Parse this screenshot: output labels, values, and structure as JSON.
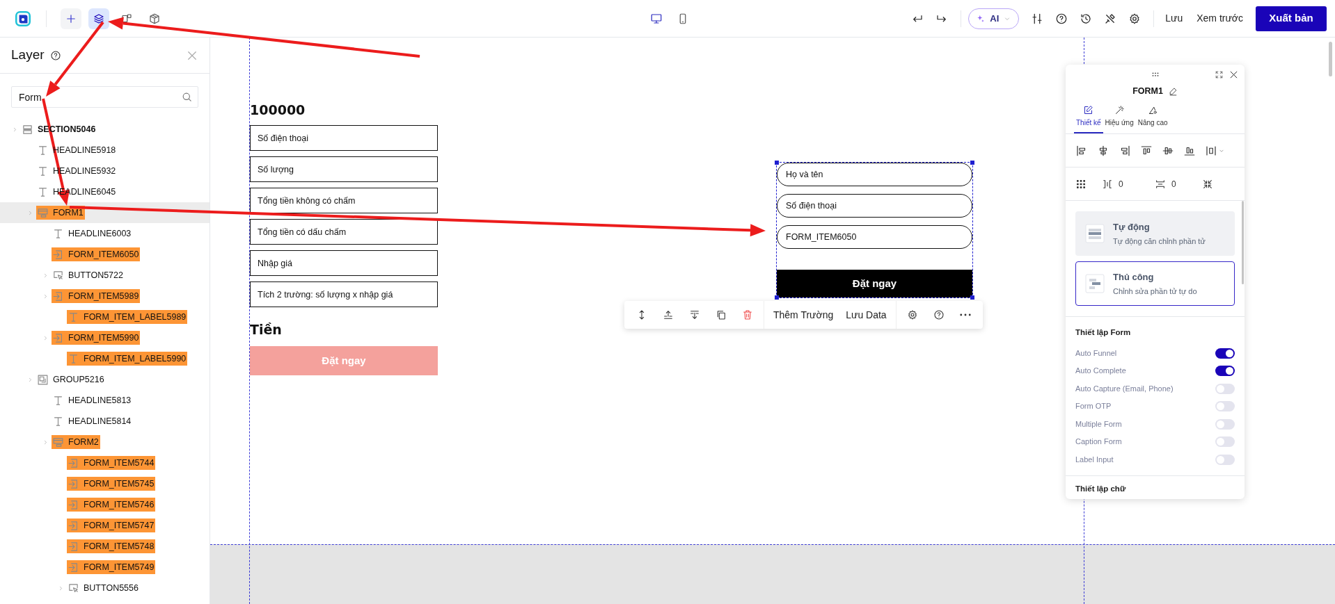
{
  "topbar": {
    "left_tools": [
      {
        "kind": "add",
        "selected": false
      },
      {
        "kind": "layers",
        "selected": true
      },
      {
        "kind": "pages",
        "selected": false
      },
      {
        "kind": "box",
        "selected": false
      }
    ],
    "devices": [
      {
        "kind": "desktop",
        "selected": true
      },
      {
        "kind": "mobile",
        "selected": false
      }
    ],
    "ai_label": "AI",
    "save": "Lưu",
    "preview": "Xem trước",
    "publish": "Xuất bản"
  },
  "layer_panel": {
    "title": "Layer",
    "search": {
      "value": "Form"
    },
    "tree": [
      {
        "label": "SECTION5046",
        "kind": "section",
        "expandable": true,
        "match": false,
        "selected": false,
        "children": [
          {
            "label": "HEADLINE5918",
            "kind": "headline",
            "expandable": false,
            "match": false,
            "selected": false
          },
          {
            "label": "HEADLINE5932",
            "kind": "headline",
            "expandable": false,
            "match": false,
            "selected": false
          },
          {
            "label": "HEADLINE6045",
            "kind": "headline",
            "expandable": false,
            "match": false,
            "selected": false
          },
          {
            "label": "FORM1",
            "kind": "form",
            "expandable": true,
            "match": true,
            "selected": true,
            "children": [
              {
                "label": "HEADLINE6003",
                "kind": "headline",
                "expandable": false,
                "match": false,
                "selected": false
              },
              {
                "label": "FORM_ITEM6050",
                "kind": "form_item",
                "expandable": false,
                "match": true,
                "selected": false
              },
              {
                "label": "BUTTON5722",
                "kind": "button",
                "expandable": true,
                "match": false,
                "selected": false
              },
              {
                "label": "FORM_ITEM5989",
                "kind": "form_item",
                "expandable": true,
                "match": true,
                "selected": false,
                "children": [
                  {
                    "label": "FORM_ITEM_LABEL5989",
                    "kind": "label",
                    "expandable": false,
                    "match": true,
                    "selected": false
                  }
                ]
              },
              {
                "label": "FORM_ITEM5990",
                "kind": "form_item",
                "expandable": true,
                "match": true,
                "selected": false,
                "children": [
                  {
                    "label": "FORM_ITEM_LABEL5990",
                    "kind": "label",
                    "expandable": false,
                    "match": true,
                    "selected": false
                  }
                ]
              }
            ]
          },
          {
            "label": "GROUP5216",
            "kind": "group",
            "expandable": true,
            "match": false,
            "selected": false,
            "children": [
              {
                "label": "HEADLINE5813",
                "kind": "headline",
                "expandable": false,
                "match": false,
                "selected": false
              },
              {
                "label": "HEADLINE5814",
                "kind": "headline",
                "expandable": false,
                "match": false,
                "selected": false
              },
              {
                "label": "FORM2",
                "kind": "form",
                "expandable": true,
                "match": true,
                "selected": false,
                "children": [
                  {
                    "label": "FORM_ITEM5744",
                    "kind": "form_item",
                    "expandable": false,
                    "match": true,
                    "selected": false
                  },
                  {
                    "label": "FORM_ITEM5745",
                    "kind": "form_item",
                    "expandable": false,
                    "match": true,
                    "selected": false
                  },
                  {
                    "label": "FORM_ITEM5746",
                    "kind": "form_item",
                    "expandable": false,
                    "match": true,
                    "selected": false
                  },
                  {
                    "label": "FORM_ITEM5747",
                    "kind": "form_item",
                    "expandable": false,
                    "match": true,
                    "selected": false
                  },
                  {
                    "label": "FORM_ITEM5748",
                    "kind": "form_item",
                    "expandable": false,
                    "match": true,
                    "selected": false
                  },
                  {
                    "label": "FORM_ITEM5749",
                    "kind": "form_item",
                    "expandable": false,
                    "match": true,
                    "selected": false
                  },
                  {
                    "label": "BUTTON5556",
                    "kind": "button",
                    "expandable": true,
                    "match": false,
                    "selected": false
                  }
                ]
              }
            ]
          }
        ]
      }
    ]
  },
  "canvas": {
    "left_form": {
      "amount": "100000",
      "fields": [
        {
          "placeholder": "Số điện thoại"
        },
        {
          "placeholder": "Số lượng"
        },
        {
          "placeholder": "Tổng tiền không có chấm"
        },
        {
          "placeholder": "Tổng tiền có dấu chấm"
        },
        {
          "placeholder": "Nhập giá"
        },
        {
          "placeholder": "Tích 2 trường: số lượng x nhập giá"
        }
      ],
      "total_label": "Tiền",
      "button": "Đặt ngay"
    },
    "right_form": {
      "fields": [
        {
          "placeholder": "Họ và tên"
        },
        {
          "placeholder": "Số điện thoại"
        },
        {
          "placeholder": "FORM_ITEM6050"
        }
      ],
      "button": "Đặt ngay"
    },
    "toolbar": {
      "actions": [
        "Thêm Trường",
        "Lưu Data"
      ]
    }
  },
  "properties": {
    "title": "FORM1",
    "tabs": [
      {
        "label": "Thiết kế",
        "kind": "design",
        "selected": true
      },
      {
        "label": "Hiệu ứng",
        "kind": "effects",
        "selected": false
      },
      {
        "label": "Nâng cao",
        "kind": "advanced",
        "selected": false
      }
    ],
    "spacing": [
      "0",
      "0"
    ],
    "modes": [
      {
        "title": "Tự động",
        "subtitle": "Tự động căn chỉnh phần tử",
        "kind": "auto",
        "selected": false
      },
      {
        "title": "Thủ công",
        "subtitle": "Chỉnh sửa phần tử tự do",
        "kind": "manual",
        "selected": true
      }
    ],
    "form_settings": {
      "heading": "Thiết lập Form",
      "toggles": [
        {
          "label": "Auto Funnel",
          "on": true
        },
        {
          "label": "Auto Complete",
          "on": true
        },
        {
          "label": "Auto Capture (Email, Phone)",
          "on": false
        },
        {
          "label": "Form OTP",
          "on": false
        },
        {
          "label": "Multiple Form",
          "on": false
        },
        {
          "label": "Caption Form",
          "on": false
        },
        {
          "label": "Label Input",
          "on": false
        }
      ]
    },
    "next_heading": "Thiết lập chữ"
  }
}
